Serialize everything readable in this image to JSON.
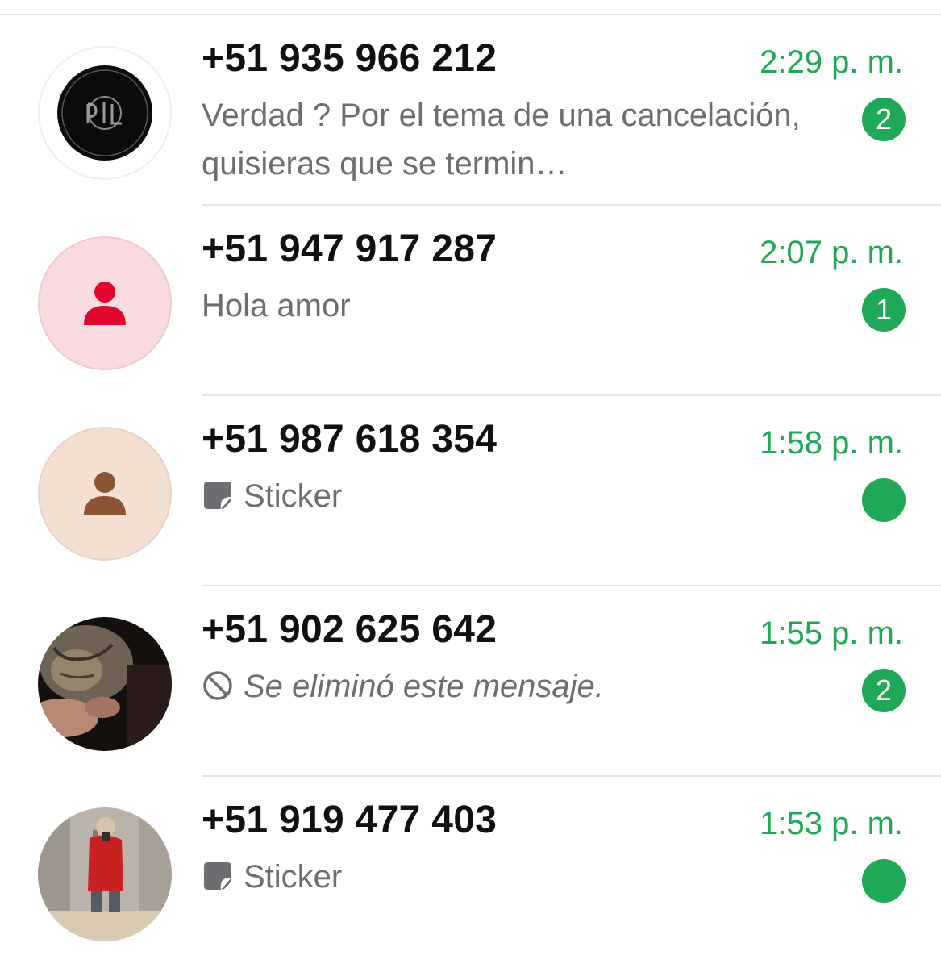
{
  "colors": {
    "accent": "#1fa855",
    "divider": "#e4e4e4",
    "name_text": "#111111",
    "preview_text": "#6d6d72"
  },
  "chats": [
    {
      "name": "+51 935 966 212",
      "time": "2:29 p. m.",
      "preview": "Verdad ? Por el tema de una cancelación, quisieras que se termin…",
      "preview_type": "text",
      "unread": "2",
      "avatar": "logo-photo"
    },
    {
      "name": "+51 947 917 287",
      "time": "2:07 p. m.",
      "preview": "Hola amor",
      "preview_type": "text",
      "unread": "1",
      "avatar": "default-person-pink"
    },
    {
      "name": "+51 987 618 354",
      "time": "1:58 p. m.",
      "preview": "Sticker",
      "preview_type": "sticker",
      "preview_icon": "sticker-icon",
      "unread": "",
      "avatar": "default-person-tan"
    },
    {
      "name": "+51 902 625 642",
      "time": "1:55 p. m.",
      "preview": "Se eliminó este mensaje.",
      "preview_type": "deleted",
      "preview_icon": "deleted-message-icon",
      "unread": "2",
      "avatar": "cat-photo"
    },
    {
      "name": "+51 919 477 403",
      "time": "1:53 p. m.",
      "preview": "Sticker",
      "preview_type": "sticker",
      "preview_icon": "sticker-icon",
      "unread": "",
      "avatar": "mirror-selfie-photo"
    }
  ]
}
